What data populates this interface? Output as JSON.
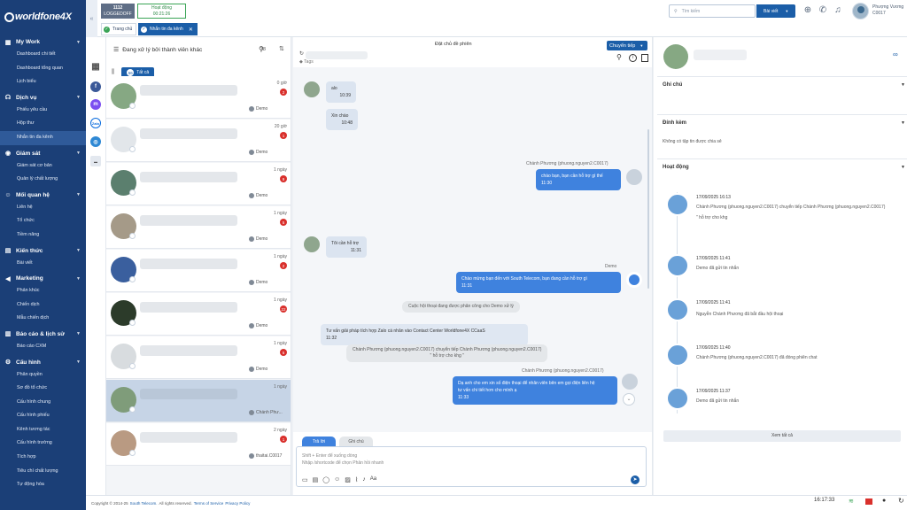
{
  "sidebar": {
    "logo": "worldfone4X",
    "sections": [
      {
        "title": "My Work",
        "items": [
          "Dashboard chi tiết",
          "Dashboard tổng quan",
          "Lịch biểu"
        ]
      },
      {
        "title": "Dịch vụ",
        "items": [
          "Phiếu yêu cầu",
          "Hộp thư",
          "Nhắn tin đa kênh"
        ]
      },
      {
        "title": "Giám sát",
        "items": [
          "Giám sát cơ bản",
          "Quản lý chất lượng"
        ]
      },
      {
        "title": "Mối quan hệ",
        "items": [
          "Liên hệ",
          "Tổ chức",
          "Tiềm năng"
        ]
      },
      {
        "title": "Kiến thức",
        "items": [
          "Bài viết"
        ]
      },
      {
        "title": "Marketing",
        "items": [
          "Phản khúc",
          "Chiến dịch",
          "Mẫu chiến dịch"
        ]
      },
      {
        "title": "Báo cáo & lịch sử",
        "items": [
          "Báo cáo CXM"
        ]
      },
      {
        "title": "Cấu hình",
        "items": [
          "Phân quyền",
          "Sơ đồ tổ chức",
          "Cấu hình chung",
          "Cấu hình phiếu",
          "Kênh tương tác",
          "Cấu hình trường",
          "Tích hợp",
          "Tiêu chí chất lượng",
          "Tự động hóa"
        ]
      }
    ],
    "active_item": "Nhắn tin đa kênh"
  },
  "topbar": {
    "status_ext": "1112",
    "status_state": "LOGGEDOFF",
    "activity_label": "Hoạt động",
    "activity_time": "00:21:26",
    "tabs": [
      "Trang chủ",
      "Nhắn tin đa kênh"
    ],
    "search_placeholder": "Tìm kiếm",
    "search_scope": "Bài viết",
    "user_name": "Phượng Vương",
    "user_code": "C0017"
  },
  "convlist": {
    "filter_label": "Đang xử lý bởi thành viên khác",
    "count": "38",
    "all_label": "Tất cả",
    "all_count": "56",
    "rows": [
      {
        "time": "0 giờ",
        "badge": "2",
        "agent": "Demo"
      },
      {
        "time": "20 giờ",
        "badge": "1",
        "agent": "Demo"
      },
      {
        "time": "1 ngày",
        "badge": "9",
        "agent": "Demo"
      },
      {
        "time": "1 ngày",
        "badge": "5",
        "agent": "Demo"
      },
      {
        "time": "1 ngày",
        "badge": "2",
        "agent": "Demo"
      },
      {
        "time": "1 ngày",
        "badge": "22",
        "agent": "Demo"
      },
      {
        "time": "1 ngày",
        "badge": "5",
        "agent": "Demo"
      },
      {
        "time": "1 ngày",
        "badge": "",
        "agent": "Chánh Phư..."
      },
      {
        "time": "2 ngày",
        "badge": "1",
        "agent": "thaitai.C0017"
      }
    ]
  },
  "chat": {
    "title": "Đặt chủ đề phiên",
    "transfer_label": "Chuyển tiếp",
    "tags_label": "Tags",
    "msg1_text": "alo",
    "msg1_time": "10:39",
    "msg2_text": "Xin chào",
    "msg2_time": "10:48",
    "out1_sender": "Chánh Phương (phuong.nguyen2.C0017)",
    "out1_text": "chào bạn, bạn cần hỗ trợ gì thế",
    "out1_time": "11:30",
    "msg3_text": "Tôi cần hỗ trợ",
    "msg3_time": "11:31",
    "demo_sender": "Demo",
    "demo_text": "Chào mừng bạn đến với South Telecom, bạn đang cần hỗ trợ gì",
    "demo_time": "11:31",
    "sys1": "Cuộc hội thoại đang được phân công cho Demo xử lý",
    "note_text": "Tư vấn giải pháp tích hợp Zalo cá nhân vào Contact Center Worldfone4X CCaaS",
    "note_time": "11:32",
    "sys2_line1": "Chánh Phương (phuong.nguyen2.C0017) chuyển tiếp Chánh Phương (phuong.nguyen2.C0017)",
    "sys2_line2": "\" hỗ trợ cho khg \"",
    "out2_sender": "Chánh Phương (phuong.nguyen2.C0017)",
    "out2_line1": "Dạ anh cho em xin số điện thoại để nhân viên bên em gọi điện liên hệ",
    "out2_line2": "tư vấn chi tiết hơn cho mình ạ",
    "out2_time": "11:33",
    "reply_tab": "Trả lời",
    "note_tab": "Ghi chú",
    "compose_line1": "Shift + Enter để xuống dòng",
    "compose_line2": "Nhập /shortcode để chọn Phản hồi nhanh"
  },
  "right": {
    "notes_title": "Ghi chú",
    "attach_title": "Đính kèm",
    "attach_empty": "Không có tập tin được chia sẻ",
    "activity_title": "Hoạt động",
    "activities": [
      {
        "when": "17/09/2025 16:13",
        "desc": "Chánh Phương (phuong.nguyen2.C0017) chuyển tiếp Chánh Phương (phuong.nguyen2.C0017)",
        "extra": "\" hỗ trợ cho khg"
      },
      {
        "when": "17/09/2025 11:41",
        "desc": "Demo đã gửi tin nhắn",
        "extra": ""
      },
      {
        "when": "17/09/2025 11:41",
        "desc": "Nguyễn Chánh Phương đã bắt đầu hội thoại",
        "extra": ""
      },
      {
        "when": "17/09/2025 11:40",
        "desc": "Chánh Phương (phuong.nguyen2.C0017) đã đóng phiên chat",
        "extra": ""
      },
      {
        "when": "17/09/2025 11:37",
        "desc": "Demo đã gửi tin nhắn",
        "extra": ""
      }
    ],
    "see_all": "Xem tất cả"
  },
  "footer": {
    "copyright": "Copyright © 2014-25",
    "company": "South Telecom.",
    "rights": "All rights reserved.",
    "terms": "Terms of Service",
    "privacy": "Privacy Policy",
    "clock": "16:17:33"
  }
}
